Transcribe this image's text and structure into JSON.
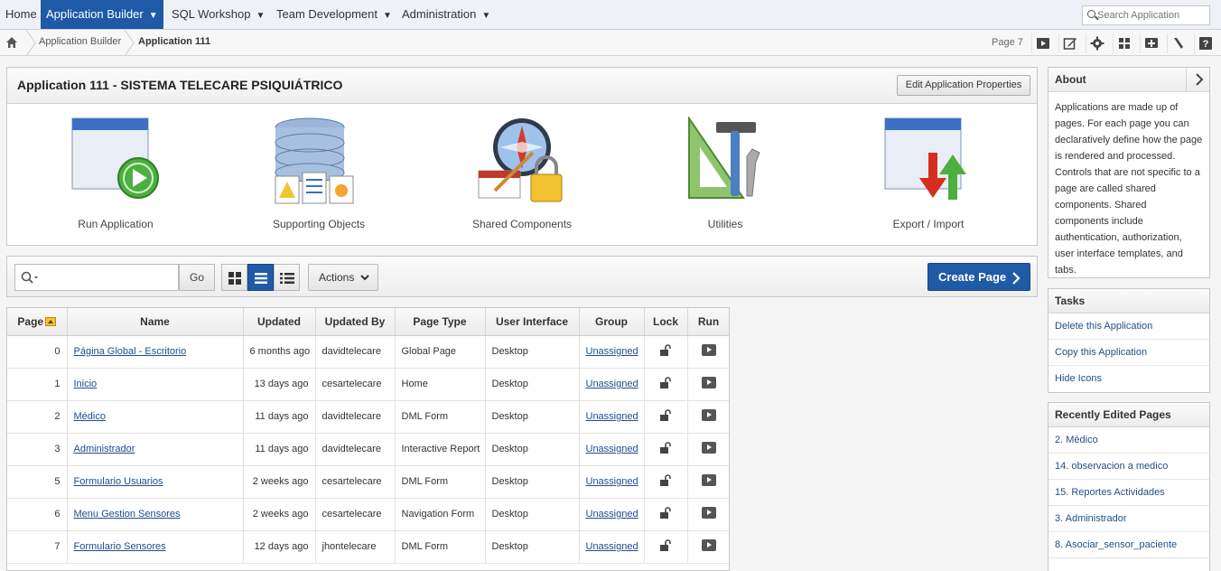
{
  "topnav": {
    "home": "Home",
    "app_builder": "Application Builder",
    "sql_workshop": "SQL Workshop",
    "team_dev": "Team Development",
    "administration": "Administration",
    "search_placeholder": "Search Application"
  },
  "breadcrumb": {
    "items": [
      "Application Builder",
      "Application 111"
    ],
    "page_label": "Page 7"
  },
  "app": {
    "title": "Application 111 - SISTEMA TELECARE PSIQUIÁTRICO",
    "edit_button": "Edit Application Properties",
    "tiles": [
      "Run Application",
      "Supporting Objects",
      "Shared Components",
      "Utilities",
      "Export / Import"
    ]
  },
  "toolbar": {
    "go": "Go",
    "actions": "Actions",
    "create_page": "Create Page"
  },
  "table": {
    "headers": [
      "Page",
      "Name",
      "Updated",
      "Updated By",
      "Page Type",
      "User Interface",
      "Group",
      "Lock",
      "Run"
    ],
    "rows": [
      {
        "page": "0",
        "name": "Página Global - Escritorio",
        "updated": "6 months ago",
        "by": "davidtelecare",
        "type": "Global Page",
        "ui": "Desktop",
        "group": "Unassigned"
      },
      {
        "page": "1",
        "name": "Inicio",
        "updated": "13 days ago",
        "by": "cesartelecare",
        "type": "Home",
        "ui": "Desktop",
        "group": "Unassigned"
      },
      {
        "page": "2",
        "name": "Médico",
        "updated": "11 days ago",
        "by": "davidtelecare",
        "type": "DML Form",
        "ui": "Desktop",
        "group": "Unassigned"
      },
      {
        "page": "3",
        "name": "Administrador",
        "updated": "11 days ago",
        "by": "davidtelecare",
        "type": "Interactive Report",
        "ui": "Desktop",
        "group": "Unassigned"
      },
      {
        "page": "5",
        "name": "Formulario Usuarios",
        "updated": "2 weeks ago",
        "by": "cesartelecare",
        "type": "DML Form",
        "ui": "Desktop",
        "group": "Unassigned"
      },
      {
        "page": "6",
        "name": "Menu Gestion Sensores",
        "updated": "2 weeks ago",
        "by": "cesartelecare",
        "type": "Navigation Form",
        "ui": "Desktop",
        "group": "Unassigned"
      },
      {
        "page": "7",
        "name": "Formulario Sensores",
        "updated": "12 days ago",
        "by": "jhontelecare",
        "type": "DML Form",
        "ui": "Desktop",
        "group": "Unassigned"
      }
    ]
  },
  "about": {
    "title": "About",
    "text": "Applications are made up of pages. For each page you can declaratively define how the page is rendered and processed. Controls that are not specific to a page are called shared components. Shared components include authentication, authorization, user interface templates, and tabs."
  },
  "tasks": {
    "title": "Tasks",
    "items": [
      "Delete this Application",
      "Copy this Application",
      "Hide Icons"
    ]
  },
  "recent": {
    "title": "Recently Edited Pages",
    "items": [
      "2. Médico",
      "14. observacion a medico",
      "15. Reportes Actividades",
      "3. Administrador",
      "8. Asociar_sensor_paciente"
    ]
  },
  "colors": {
    "brand_blue": "#1f5aa6",
    "link": "#1a4d8f"
  }
}
